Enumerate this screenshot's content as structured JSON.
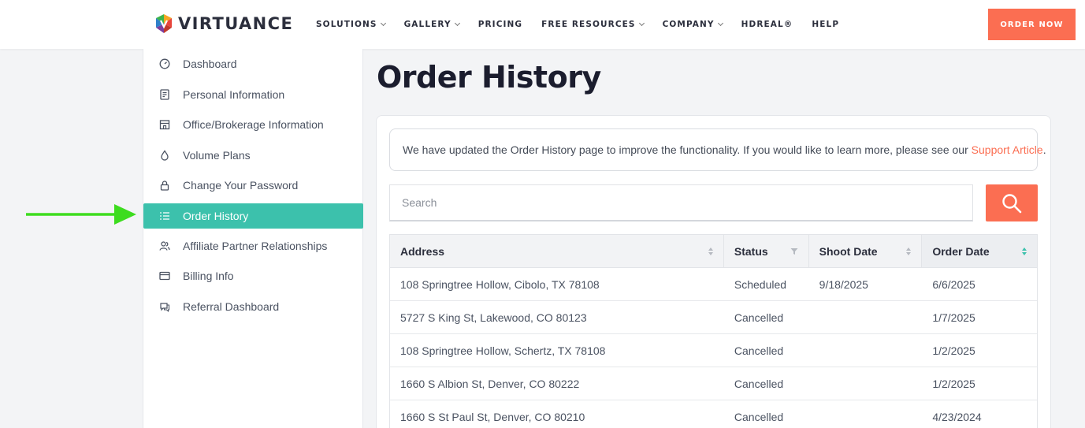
{
  "brand": {
    "name": "VIRTUANCE"
  },
  "nav": [
    {
      "label": "SOLUTIONS",
      "dropdown": true
    },
    {
      "label": "GALLERY",
      "dropdown": true
    },
    {
      "label": "PRICING",
      "dropdown": false
    },
    {
      "label": "FREE RESOURCES",
      "dropdown": true
    },
    {
      "label": "COMPANY",
      "dropdown": true
    },
    {
      "label": "HDREAL®",
      "dropdown": false
    },
    {
      "label": "HELP",
      "dropdown": false
    }
  ],
  "header": {
    "order_button": "ORDER NOW"
  },
  "sidebar": {
    "items": [
      {
        "label": "Dashboard",
        "icon": "speedometer-icon"
      },
      {
        "label": "Personal Information",
        "icon": "id-card-icon"
      },
      {
        "label": "Office/Brokerage Information",
        "icon": "building-icon"
      },
      {
        "label": "Volume Plans",
        "icon": "drop-icon"
      },
      {
        "label": "Change Your Password",
        "icon": "lock-icon"
      },
      {
        "label": "Order History",
        "icon": "list-icon",
        "active": true
      },
      {
        "label": "Affiliate Partner Relationships",
        "icon": "users-icon"
      },
      {
        "label": "Billing Info",
        "icon": "credit-card-icon"
      },
      {
        "label": "Referral Dashboard",
        "icon": "chat-icon"
      }
    ]
  },
  "main": {
    "title": "Order History",
    "notice": {
      "text": "We have updated the Order History page to improve the functionality. If you would like to learn more, please see our ",
      "link": "Support Article",
      "suffix": "."
    },
    "search": {
      "placeholder": "Search"
    }
  },
  "table": {
    "headers": [
      "Address",
      "Status",
      "Shoot Date",
      "Order Date"
    ],
    "rows": [
      [
        "108 Springtree Hollow, Cibolo, TX 78108",
        "Scheduled",
        "9/18/2025",
        "6/6/2025"
      ],
      [
        "5727 S King St, Lakewood, CO 80123",
        "Cancelled",
        "",
        "1/7/2025"
      ],
      [
        "108 Springtree Hollow, Schertz, TX 78108",
        "Cancelled",
        "",
        "1/2/2025"
      ],
      [
        "1660 S Albion St, Denver, CO 80222",
        "Cancelled",
        "",
        "1/2/2025"
      ],
      [
        "1660 S St Paul St, Denver, CO 80210",
        "Cancelled",
        "",
        "4/23/2024"
      ]
    ]
  },
  "colors": {
    "accent": "#fb6e52",
    "active": "#3cc1ac",
    "annotation_arrow": "#3ddc1f"
  }
}
